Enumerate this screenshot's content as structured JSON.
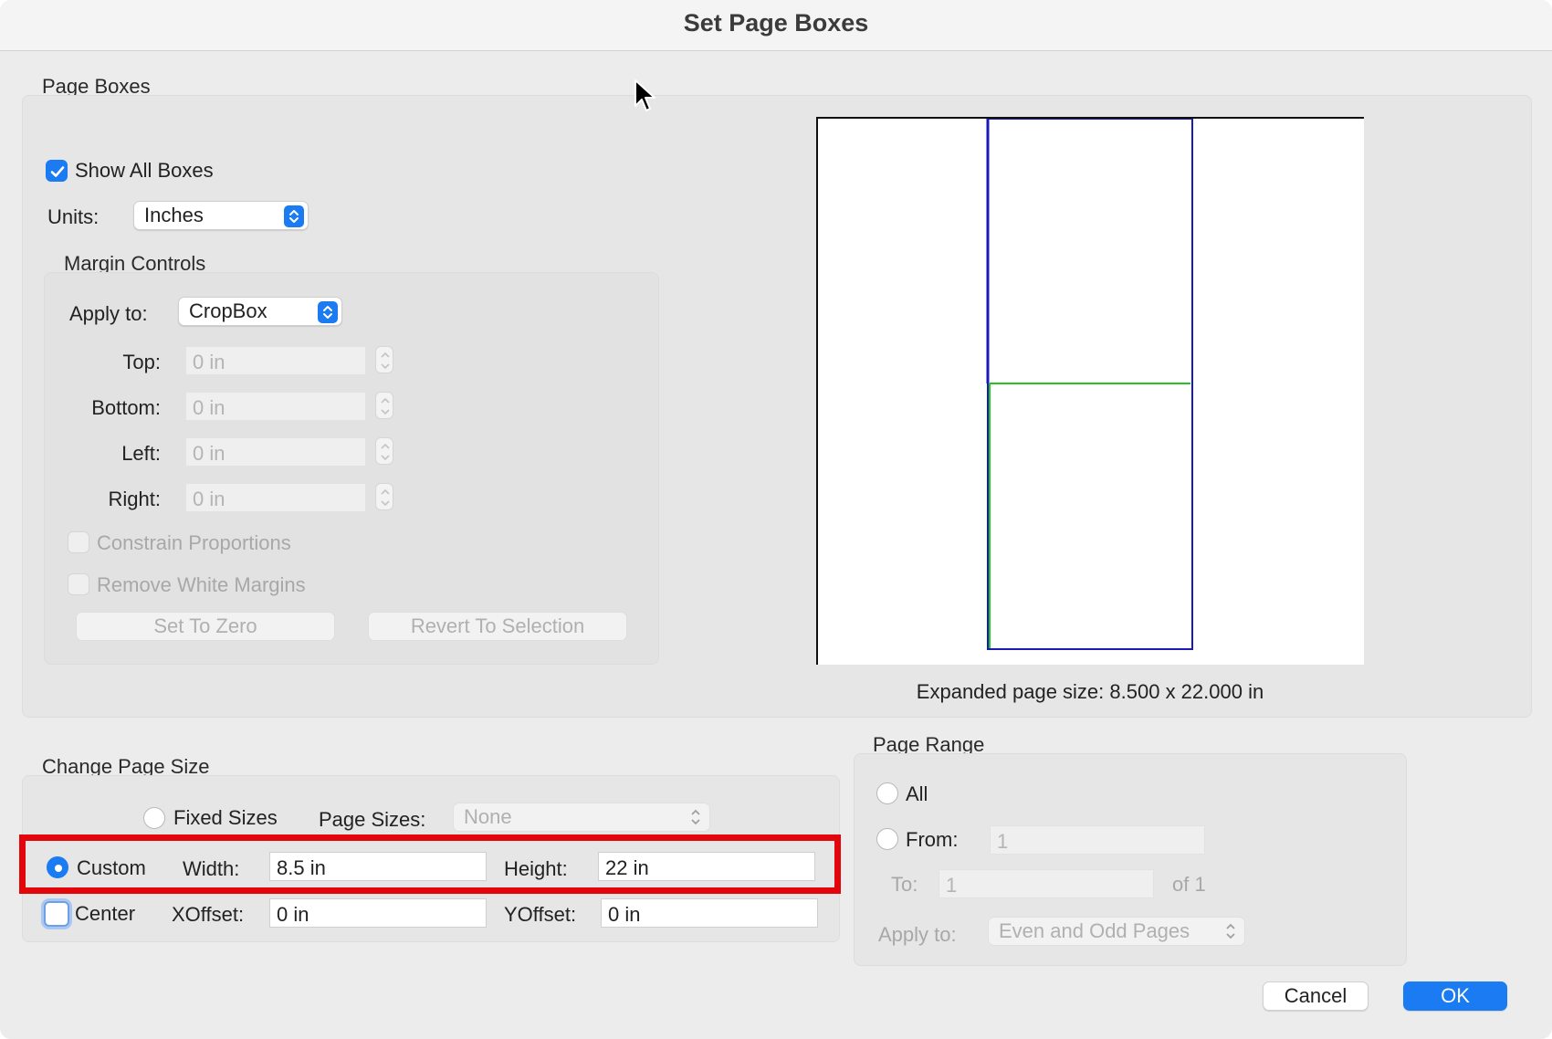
{
  "dialog": {
    "title": "Set Page Boxes"
  },
  "page_boxes": {
    "label": "Page Boxes",
    "show_all_boxes": {
      "label": "Show All Boxes",
      "checked": true
    },
    "units": {
      "label": "Units:",
      "value": "Inches"
    },
    "margin_controls": {
      "label": "Margin Controls",
      "apply_to": {
        "label": "Apply to:",
        "value": "CropBox"
      },
      "top": {
        "label": "Top:",
        "value": "0 in"
      },
      "bottom": {
        "label": "Bottom:",
        "value": "0 in"
      },
      "left": {
        "label": "Left:",
        "value": "0 in"
      },
      "right": {
        "label": "Right:",
        "value": "0 in"
      },
      "constrain_proportions": {
        "label": "Constrain Proportions",
        "checked": false
      },
      "remove_white_margins": {
        "label": "Remove White Margins",
        "checked": false
      },
      "set_to_zero": "Set To Zero",
      "revert_to_selection": "Revert To Selection"
    },
    "expanded_size": "Expanded page size: 8.500 x 22.000 in"
  },
  "change_page_size": {
    "label": "Change Page Size",
    "fixed_sizes": {
      "label": "Fixed Sizes",
      "selected": false
    },
    "page_sizes": {
      "label": "Page Sizes:",
      "value": "None"
    },
    "custom": {
      "label": "Custom",
      "selected": true
    },
    "width": {
      "label": "Width:",
      "value": "8.5 in"
    },
    "height": {
      "label": "Height:",
      "value": "22 in"
    },
    "center": {
      "label": "Center",
      "checked": false
    },
    "xoffset": {
      "label": "XOffset:",
      "value": "0 in"
    },
    "yoffset": {
      "label": "YOffset:",
      "value": "0 in"
    }
  },
  "page_range": {
    "label": "Page Range",
    "all": {
      "label": "All",
      "selected": false
    },
    "from": {
      "label": "From:",
      "value": "1"
    },
    "to": {
      "label": "To:",
      "value": "1",
      "of": "of 1"
    },
    "apply_to": {
      "label": "Apply to:",
      "value": "Even and Odd Pages"
    }
  },
  "buttons": {
    "cancel": "Cancel",
    "ok": "OK"
  },
  "colors": {
    "accent": "#1a7bf2",
    "highlight": "#e3050c",
    "box_blue": "#1a1ab8",
    "box_green": "#22c322"
  }
}
